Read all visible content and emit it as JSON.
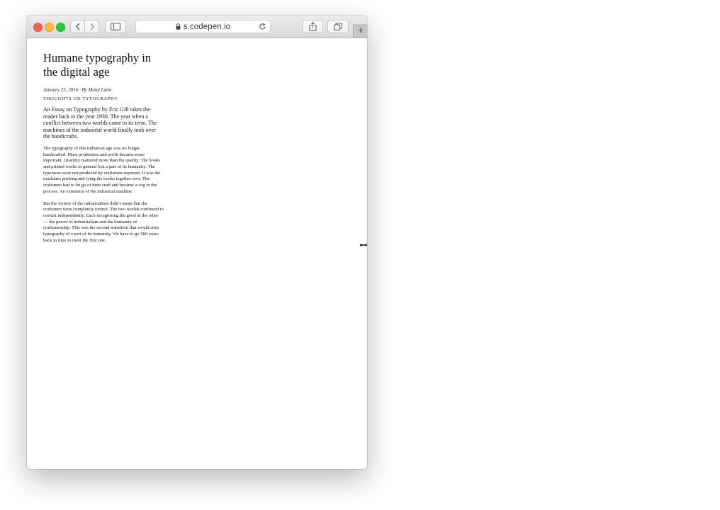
{
  "browser": {
    "address": "s.codepen.io",
    "new_tab": "+"
  },
  "article": {
    "title": "Humane typography in the digital age",
    "meta": "January 25, 2016 · By Matej Latin",
    "section": "Thoughts on typography",
    "lead": "An Essay on Typography by Eric Gill takes the reader back to the year 1930. The year when a conflict between two worlds came to its term. The machines of the industrial world finally took over the handicrafts.",
    "paragraphs": [
      "The typography of this industrial age was no longer handcrafted. Mass production and profit became more important. Quantity mattered more than the quality. The books and printed works in general lost a part of its humanity. The typefaces were not produced by craftsmen anymore. It was the machines printing and tying the books together now. The craftsmen had to let go of their craft and became a cog in the process. An extension of the industrial machine.",
      "But the victory of the industrialism didn’t mean that the craftsmen were completely extinct. The two worlds continued to coexist independently. Each recognising the good in the other — the power of industrialism and the humanity of craftsmanship. This was the second transition that would strip typography of a part of its humanity. We have to go 500 years back in time to meet the first one."
    ]
  },
  "icons": {
    "close": "close-traffic-light-icon",
    "minimize": "minimize-traffic-light-icon",
    "maximize": "maximize-traffic-light-icon",
    "back": "chevron-left-icon",
    "forward": "chevron-right-icon",
    "sidebar": "sidebar-icon",
    "lock": "lock-icon",
    "reload": "reload-icon",
    "share": "share-icon",
    "tabs": "tabs-overview-icon",
    "cursor": "resize-horizontal-cursor-icon"
  },
  "colors": {
    "close": "#fc5f57",
    "minimize": "#fdbc2e",
    "maximize": "#28c840",
    "toolbar": "#e3e3e3"
  }
}
